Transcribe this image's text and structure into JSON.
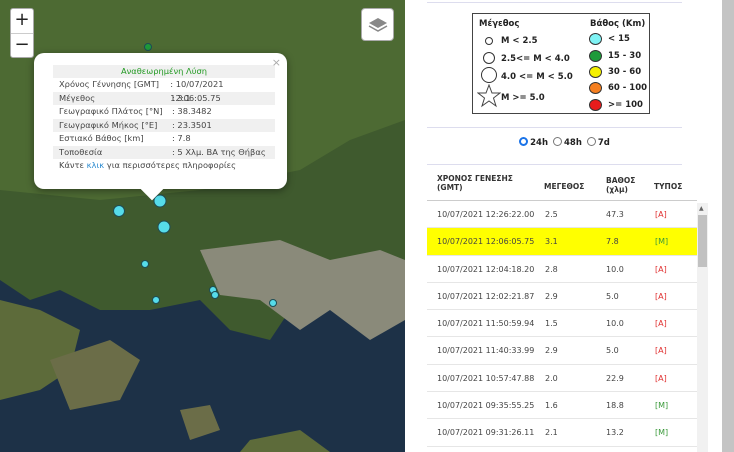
{
  "map": {
    "zoom_in": "+",
    "zoom_out": "−",
    "layers_icon": "layers-icon",
    "popup": {
      "title": "Αναθεωρημένη Λύση",
      "rows": [
        {
          "k": "Χρόνος Γέννησης [GMT]",
          "v": ": 10/07/2021 12:06:05.75"
        },
        {
          "k": "Μέγεθος",
          "v": ": 3.1"
        },
        {
          "k": "Γεωγραφικό Πλάτος [°N]",
          "v": ": 38.3482"
        },
        {
          "k": "Γεωγραφικό Μήκος [°E]",
          "v": ": 23.3501"
        },
        {
          "k": "Εστιακό Βάθος [km]",
          "v": ": 7.8"
        },
        {
          "k": "Τοποθεσία",
          "v": ": 5 Χλμ. ΒΑ της Θήβας"
        }
      ],
      "foot_pre": "Κάντε ",
      "foot_link": "κλικ",
      "foot_post": " για περισσότερες πληροφορίες",
      "close": "×"
    },
    "marker_color": "#56dcea"
  },
  "legend": {
    "mag_title": "Μέγεθος",
    "depth_title": "Βάθος (Km)",
    "mag": [
      "M < 2.5",
      "2.5<= M < 4.0",
      "4.0 <= M < 5.0",
      "M >= 5.0"
    ],
    "depth": [
      {
        "label": "< 15",
        "color": "#7ff3f5"
      },
      {
        "label": "15 - 30",
        "color": "#1e9a3a"
      },
      {
        "label": "30 - 60",
        "color": "#f5f000"
      },
      {
        "label": "60 - 100",
        "color": "#f57f20"
      },
      {
        "label": ">= 100",
        "color": "#e81c1c"
      }
    ]
  },
  "period": {
    "options": [
      "24h",
      "48h",
      "7d"
    ],
    "selected": "24h"
  },
  "table": {
    "headers": {
      "time": "ΧΡΟΝΟΣ ΓΕΝΕΣΗΣ",
      "time2": "(GMT)",
      "mag": "ΜΕΓΕΘΟΣ",
      "depth": "ΒΑΘΟΣ",
      "depth2": "(χλμ)",
      "type": "ΤΥΠΟΣ"
    },
    "highlight_color": "#ffff00",
    "rows": [
      {
        "time": "10/07/2021 12:26:22.00",
        "mag": "2.5",
        "depth": "47.3",
        "type": "[A]"
      },
      {
        "time": "10/07/2021 12:06:05.75",
        "mag": "3.1",
        "depth": "7.8",
        "type": "[M]",
        "selected": true
      },
      {
        "time": "10/07/2021 12:04:18.20",
        "mag": "2.8",
        "depth": "10.0",
        "type": "[A]"
      },
      {
        "time": "10/07/2021 12:02:21.87",
        "mag": "2.9",
        "depth": "5.0",
        "type": "[A]"
      },
      {
        "time": "10/07/2021 11:50:59.94",
        "mag": "1.5",
        "depth": "10.0",
        "type": "[A]"
      },
      {
        "time": "10/07/2021 11:40:33.99",
        "mag": "2.9",
        "depth": "5.0",
        "type": "[A]"
      },
      {
        "time": "10/07/2021 10:57:47.88",
        "mag": "2.0",
        "depth": "22.9",
        "type": "[A]"
      },
      {
        "time": "10/07/2021 09:35:55.25",
        "mag": "1.6",
        "depth": "18.8",
        "type": "[M]"
      },
      {
        "time": "10/07/2021 09:31:26.11",
        "mag": "2.1",
        "depth": "13.2",
        "type": "[M]"
      }
    ]
  }
}
